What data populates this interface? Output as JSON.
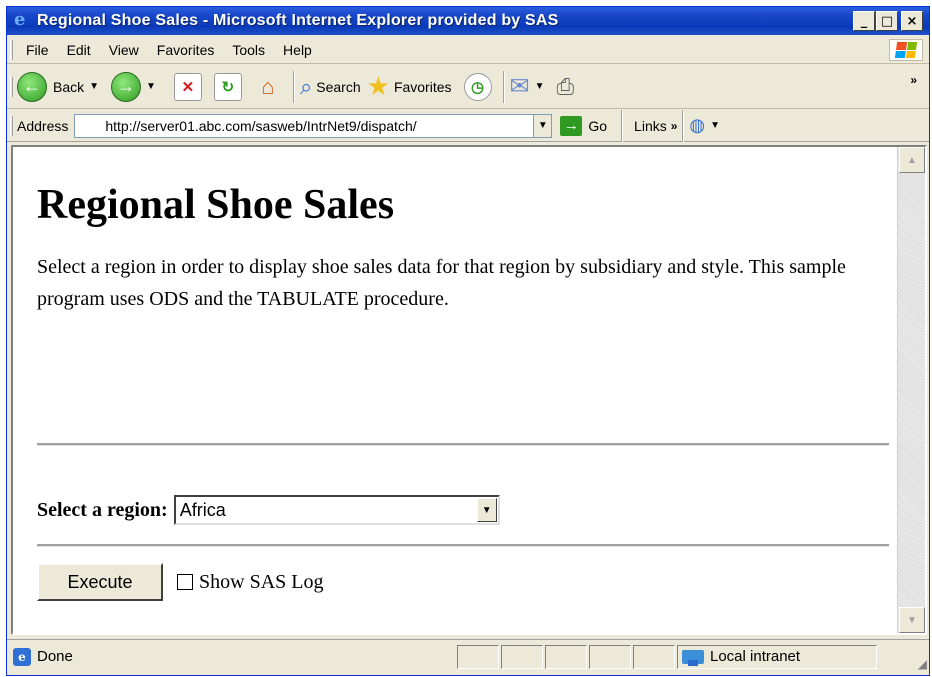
{
  "window": {
    "title": "Regional Shoe Sales - Microsoft Internet Explorer provided by SAS",
    "minimize_glyph": "_",
    "maximize_glyph": "□",
    "close_glyph": "×"
  },
  "menu": {
    "items": [
      "File",
      "Edit",
      "View",
      "Favorites",
      "Tools",
      "Help"
    ]
  },
  "toolbar": {
    "back_label": "Back",
    "search_label": "Search",
    "favorites_label": "Favorites",
    "overflow": "»"
  },
  "addressbar": {
    "label": "Address",
    "url": "http://server01.abc.com/sasweb/IntrNet9/dispatch/",
    "go_label": "Go",
    "links_label": "Links",
    "links_overflow": "»"
  },
  "page": {
    "heading": "Regional Shoe Sales",
    "description": "Select a region in order to display shoe sales data for that region by subsidiary and style. This sample program uses ODS and the TABULATE procedure.",
    "region_label": "Select a region:",
    "region_selected": "Africa",
    "execute_label": "Execute",
    "show_log_label": "Show SAS Log",
    "show_log_checked": false
  },
  "statusbar": {
    "status_text": "Done",
    "zone_text": "Local intranet"
  },
  "icons": {
    "app": "ie-icon",
    "back": "back-arrow-icon",
    "forward": "forward-arrow-icon",
    "stop": "stop-icon",
    "refresh": "refresh-icon",
    "home": "home-icon",
    "search": "search-icon",
    "favorites": "star-icon",
    "history": "history-icon",
    "mail": "mail-icon",
    "print": "print-icon"
  }
}
